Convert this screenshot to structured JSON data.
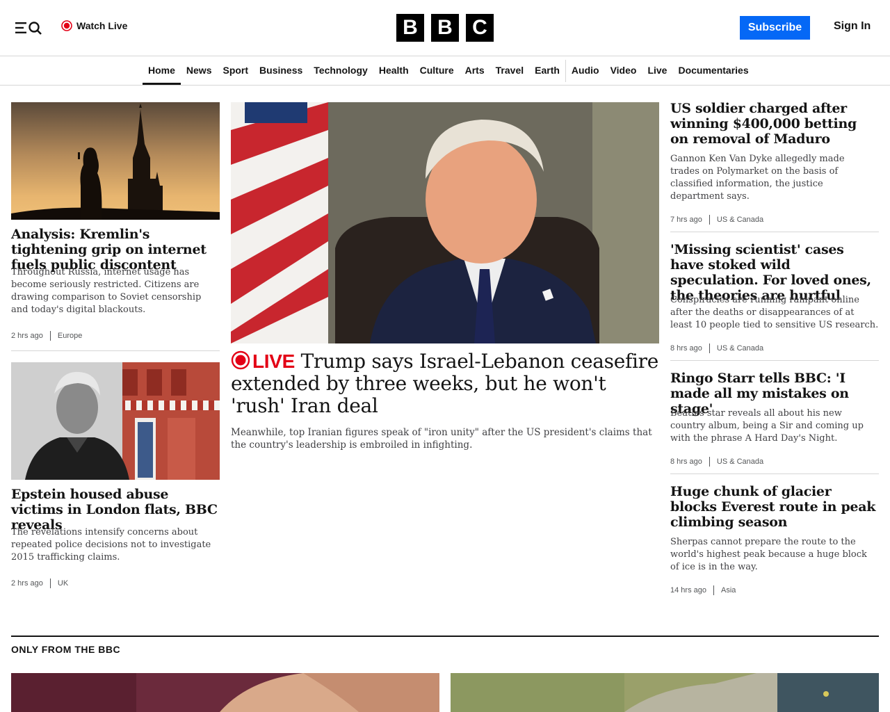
{
  "header": {
    "watch_live": "Watch Live",
    "logo_letters": [
      "B",
      "B",
      "C"
    ],
    "subscribe": "Subscribe",
    "sign_in": "Sign In",
    "colors": {
      "subscribe_bg": "#0568f6",
      "live_red": "#e30016"
    }
  },
  "nav": {
    "items": [
      "Home",
      "News",
      "Sport",
      "Business",
      "Technology",
      "Health",
      "Culture",
      "Arts",
      "Travel",
      "Earth",
      "Audio",
      "Video",
      "Live",
      "Documentaries"
    ],
    "active": "Home"
  },
  "left": [
    {
      "image": "kremlin-silhouette",
      "headline": "Analysis: Kremlin's tightening grip on internet fuels public discontent",
      "summary": "Throughout Russia, internet usage has become seriously restricted. Citizens are drawing comparison to Soviet censorship and today's digital blackouts.",
      "time": "2 hrs ago",
      "tag": "Europe"
    },
    {
      "image": "epstein-portrait-london-flats",
      "headline": "Epstein housed abuse victims in London flats, BBC reveals",
      "summary": "The revelations intensify concerns about repeated police decisions not to investigate 2015 trafficking claims.",
      "time": "2 hrs ago",
      "tag": "UK"
    }
  ],
  "main": {
    "image": "trump-oval-office",
    "live_label": "LIVE",
    "headline": "Trump says Israel-Lebanon ceasefire extended by three weeks, but he won't 'rush' Iran deal",
    "summary": "Meanwhile, top Iranian figures speak of \"iron unity\" after the US president's claims that the country's leadership is embroiled in infighting."
  },
  "right": [
    {
      "headline": "US soldier charged after winning $400,000 betting on removal of Maduro",
      "summary": "Gannon Ken Van Dyke allegedly made trades on Polymarket on the basis of classified information, the justice department says.",
      "time": "7 hrs ago",
      "tag": "US & Canada"
    },
    {
      "headline": "'Missing scientist' cases have stoked wild speculation. For loved ones, the theories are hurtful",
      "summary": "Conspiracies are running rampant online after the deaths or disappearances of at least 10 people tied to sensitive US research.",
      "time": "8 hrs ago",
      "tag": "US & Canada"
    },
    {
      "headline": "Ringo Starr tells BBC: 'I made all my mistakes on stage'",
      "summary": "Beatles star reveals all about his new country album, being a Sir and coming up with the phrase A Hard Day's Night.",
      "time": "8 hrs ago",
      "tag": "US & Canada"
    },
    {
      "headline": "Huge chunk of glacier blocks Everest route in peak climbing season",
      "summary": "Sherpas cannot prepare the route to the world's highest peak because a huge block of ice is in the way.",
      "time": "14 hrs ago",
      "tag": "Asia"
    }
  ],
  "section": {
    "title": "ONLY FROM THE BBC"
  }
}
